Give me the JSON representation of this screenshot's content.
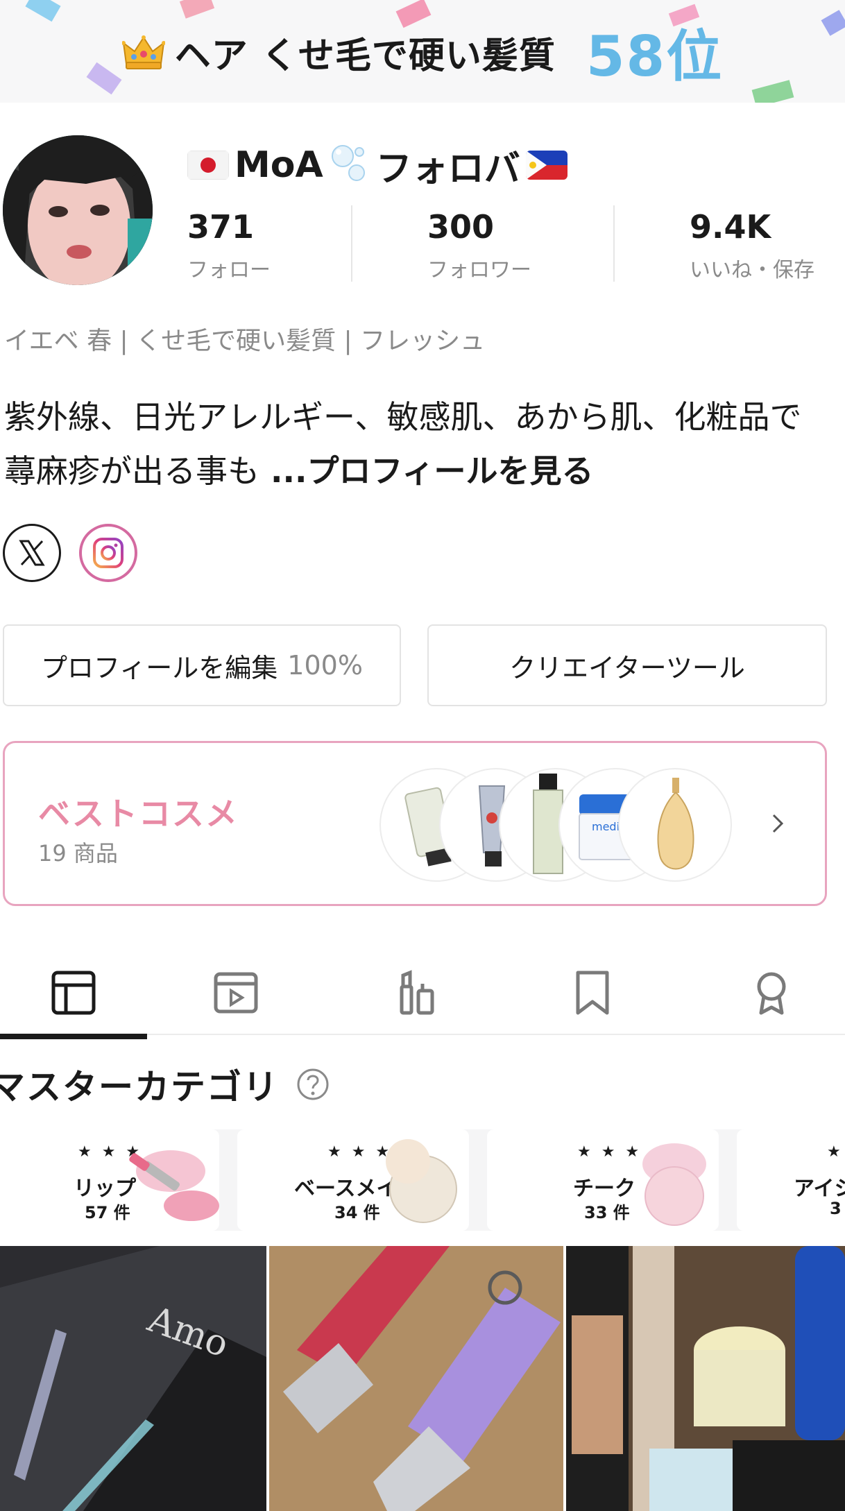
{
  "ranking": {
    "crown_icon": "crown-icon",
    "category": "ヘア くせ毛で硬い髪質",
    "rank": "58位",
    "rank_color": "#64b8e6"
  },
  "profile": {
    "username": "MoA",
    "username_suffix": "フォロバ",
    "stats": [
      {
        "value": "371",
        "label": "フォロー"
      },
      {
        "value": "300",
        "label": "フォロワー"
      },
      {
        "value": "9.4K",
        "label": "いいね・保存"
      }
    ],
    "attributes": "イエベ 春 | くせ毛で硬い髪質 | フレッシュ",
    "bio": "紫外線、日光アレルギー、敏感肌、あから肌、化粧品で蕁麻疹が出る事も",
    "bio_more": " ...プロフィールを見る",
    "social": [
      "x-icon",
      "instagram-icon"
    ]
  },
  "actions": {
    "edit_label": "プロフィールを編集",
    "edit_progress": "100%",
    "creator_label": "クリエイターツール"
  },
  "best_cosme": {
    "title": "ベストコスメ",
    "count": "19 商品",
    "accent": "#e88aa5"
  },
  "tabs": [
    "grid-icon",
    "video-icon",
    "cosmetics-icon",
    "bookmark-icon",
    "award-icon"
  ],
  "master_category": {
    "title": "マスターカテゴリ",
    "items": [
      {
        "name": "リップ",
        "count": "57 件",
        "stars": "★ ★ ★"
      },
      {
        "name": "ベースメイク",
        "count": "34 件",
        "stars": "★ ★ ★"
      },
      {
        "name": "チーク",
        "count": "33 件",
        "stars": "★ ★ ★"
      },
      {
        "name": "アイシ",
        "count": "3",
        "stars": "★"
      }
    ]
  }
}
